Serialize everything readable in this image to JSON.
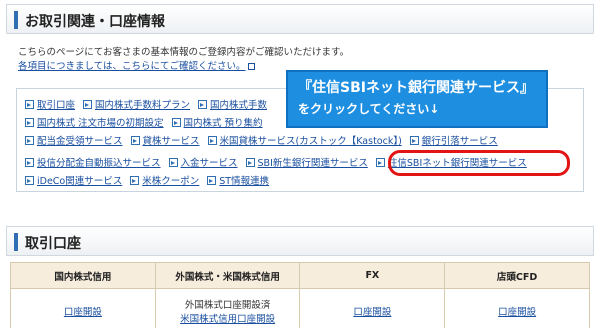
{
  "section1": {
    "title": "お取引関連・口座情報"
  },
  "intro": {
    "text": "こちらのページにてお客さまの基本情報のご登録内容がご確認いただけます。",
    "link": "各項目につきましては、こちらにてご確認ください。"
  },
  "links": {
    "row1": [
      "取引口座",
      "国内株式手数料プラン",
      "国内株式手数"
    ],
    "row2": [
      "国内株式 注文市場の初期設定",
      "国内株式 預り集約"
    ],
    "row3": [
      "配当金受領サービス",
      "貸株サービス",
      "米国貸株サービス(カストック【Kastock】)",
      "銀行引落サービス"
    ],
    "row4": [
      "投信分配金自動振込サービス",
      "入金サービス",
      "SBI新生銀行関連サービス",
      "住信SBIネット銀行関連サービス"
    ],
    "row5": [
      "iDeCo関連サービス",
      "米株クーポン",
      "ST情報連携"
    ]
  },
  "callout": {
    "line1": "『住信SBIネット銀行関連サービス』",
    "line2": "をクリックしてください↓"
  },
  "section2": {
    "title": "取引口座"
  },
  "table": {
    "headers": [
      "国内株式信用",
      "外国株式・米国株式信用",
      "FX",
      "店頭CFD"
    ],
    "cells": {
      "col1_link": "口座開設",
      "col2_text": "外国株式口座開設済",
      "col2_link": "米国株式信用口座開設",
      "col3_link": "口座開設",
      "col4_link": "口座開設"
    }
  },
  "colors": {
    "accent": "#2f6fb2",
    "callout": "#1e8ee0",
    "highlight": "#e31414",
    "header_bg": "#f6eddc"
  }
}
